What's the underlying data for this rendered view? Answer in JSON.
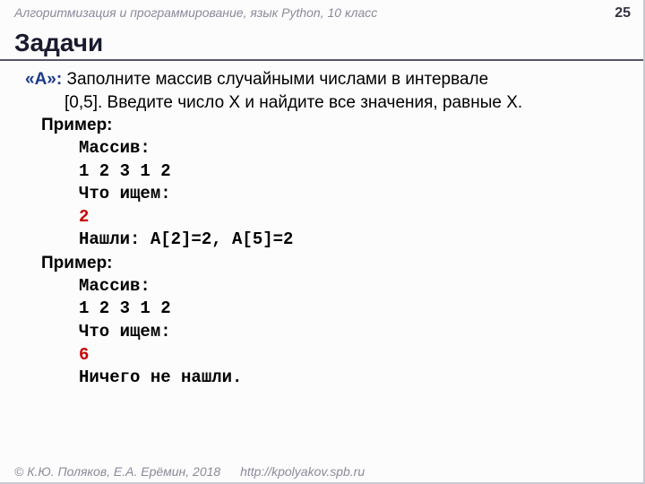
{
  "header": {
    "course": "Алгоритмизация и программирование, язык Python, 10 класс",
    "page": "25"
  },
  "title": "Задачи",
  "task": {
    "label": "«A»:",
    "line1": " Заполните массив случайными числами в интервале",
    "line2": "[0,5]. Введите число X и найдите все значения, равные X."
  },
  "primer_label": "Пример:",
  "ex1": {
    "l1": "Массив:",
    "l2": "1 2 3 1 2",
    "l3": "Что ищем:",
    "l4": "2",
    "l5": "Нашли: A[2]=2, A[5]=2"
  },
  "ex2": {
    "l1": "Массив:",
    "l2": "1 2 3 1 2",
    "l3": "Что ищем:",
    "l4": "6",
    "l5": "Ничего не нашли."
  },
  "footer": {
    "copy": "© К.Ю. Поляков, Е.А. Ерёмин, 2018",
    "url": "http://kpolyakov.spb.ru"
  }
}
